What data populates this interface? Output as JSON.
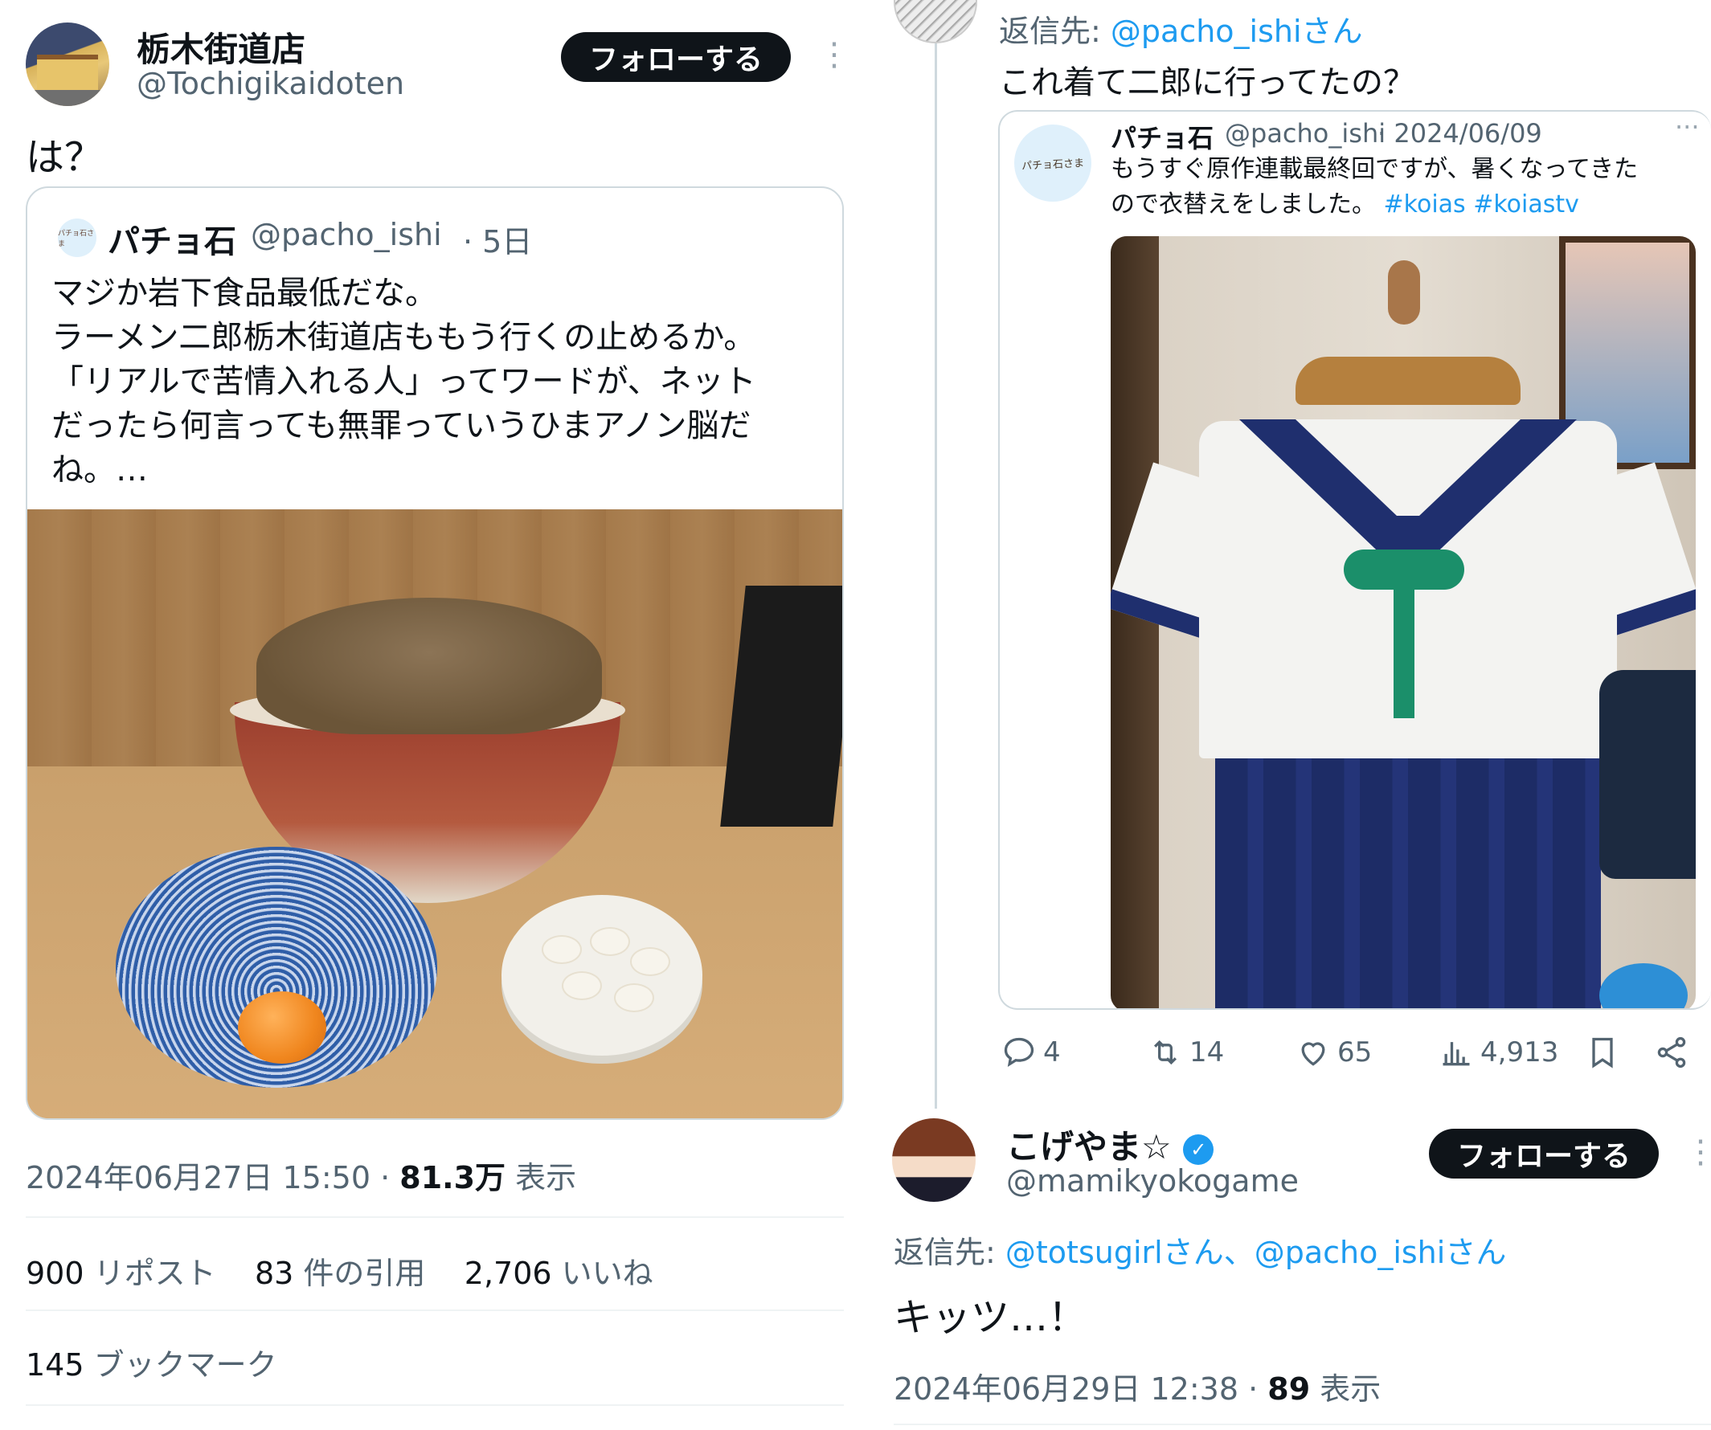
{
  "left_tweet": {
    "author_name": "栃木街道店",
    "author_handle": "@Tochigikaidoten",
    "follow_label": "フォローする",
    "more_icon": "more-dots-icon",
    "text": "は？",
    "quote": {
      "author_name": "パチョ石",
      "author_handle": "@pacho_ishi",
      "time": "· 5日",
      "avatar_text": "パチョ石さま",
      "lines": [
        "マジか岩下食品最低だな。",
        "ラーメン二郎栃木街道店ももう行くの止めるか。",
        "「リアルで苦情入れる人」ってワードが、ネット",
        "だったら何言っても無罪っていうひまアノン脳だ",
        "ね。…"
      ]
    },
    "timestamp": "2024年06月27日 15:50 ·",
    "views_count": "81.3万",
    "views_label": "表示",
    "stats": {
      "reposts_count": "900",
      "reposts_label": "リポスト",
      "quotes_count": "83",
      "quotes_label": "件の引用",
      "likes_count": "2,706",
      "likes_label": "いいね",
      "bookmarks_count": "145",
      "bookmarks_label": "ブックマーク"
    }
  },
  "right_reply": {
    "reply_prefix": "返信先:",
    "reply_mention": "@pacho_ishiさん",
    "text": "これ着て二郎に行ってたの？",
    "quote": {
      "author_name": "パチョ石",
      "author_handle": "@pacho_ishi",
      "date": "· 2024/06/09",
      "avatar_text": "パチョ石さま",
      "line1": "もうすぐ原作連載最終回ですが、暑くなってきた",
      "line2": "ので衣替えをしました。",
      "hashtags": "#koias #koiastv"
    },
    "actions": {
      "replies": "4",
      "reposts": "14",
      "likes": "65",
      "views": "4,913"
    }
  },
  "koge_reply": {
    "author_name": "こげやま☆",
    "author_handle": "@mamikyokogame",
    "verified_mark": "✓",
    "follow_label": "フォローする",
    "reply_prefix": "返信先:",
    "reply_mentions": "@totsugirlさん、@pacho_ishiさん",
    "text": "キッツ…！",
    "timestamp": "2024年06月29日 12:38 ·",
    "views_count": "89",
    "views_label": "表示"
  },
  "colors": {
    "link": "#1d9bf0",
    "secondary": "#536471",
    "primary": "#0f1419"
  }
}
